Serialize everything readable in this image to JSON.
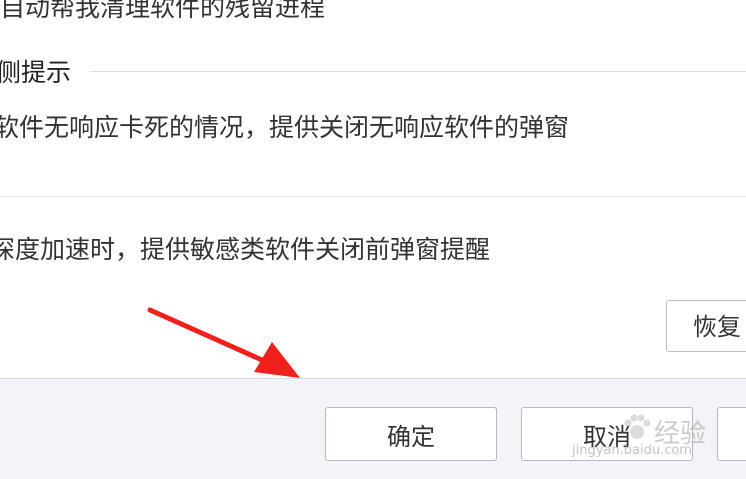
{
  "content": {
    "cut_line": "自动帮我清理软件的残留进程",
    "section_title": "侧提示",
    "desc_1": "软件无响应卡死的情况，提供关闭无响应软件的弹窗",
    "desc_2": "深度加速时，提供敏感类软件关闭前弹窗提醒",
    "restore_label": "恢复"
  },
  "footer": {
    "ok_label": "确定",
    "cancel_label": "取消"
  },
  "watermark": {
    "text": "经验",
    "url": "jingyan.baidu.com"
  },
  "colors": {
    "arrow": "#f0201c",
    "footer_bg": "#f2f4f7",
    "divider": "#e0e0e0"
  }
}
